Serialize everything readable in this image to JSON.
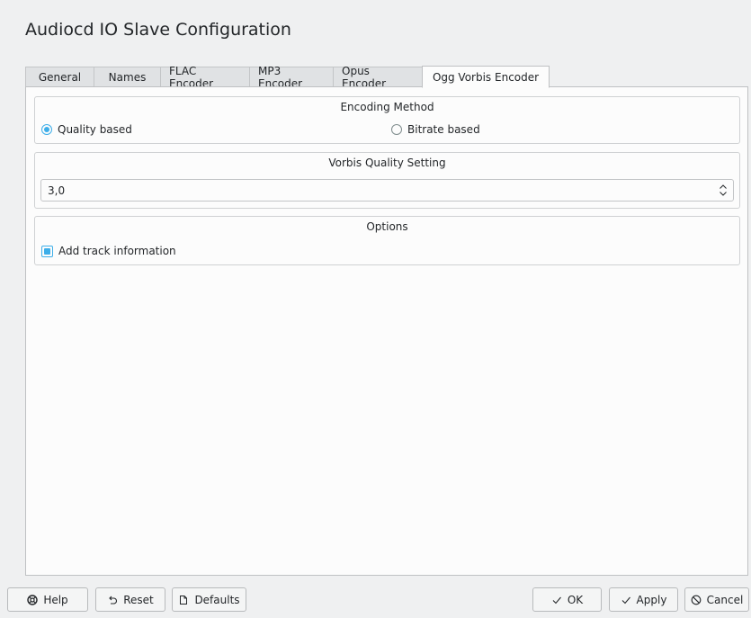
{
  "window": {
    "title": "Audiocd IO Slave Configuration"
  },
  "tabs": [
    {
      "label": "General"
    },
    {
      "label": "Names"
    },
    {
      "label": "FLAC Encoder"
    },
    {
      "label": "MP3 Encoder"
    },
    {
      "label": "Opus Encoder"
    },
    {
      "label": "Ogg Vorbis Encoder",
      "active": true
    }
  ],
  "encoding_method": {
    "title": "Encoding Method",
    "options": [
      {
        "label": "Quality based",
        "selected": true
      },
      {
        "label": "Bitrate based",
        "selected": false
      }
    ]
  },
  "quality": {
    "title": "Vorbis Quality Setting",
    "value": "3,0"
  },
  "options": {
    "title": "Options",
    "add_track_info": {
      "label": "Add track information",
      "checked": true
    }
  },
  "buttons": {
    "help": "Help",
    "reset": "Reset",
    "defaults": "Defaults",
    "ok": "OK",
    "apply": "Apply",
    "cancel": "Cancel"
  },
  "colors": {
    "accent": "#3daee9",
    "window_bg": "#eff0f1",
    "panel_bg": "#fcfcfc"
  }
}
